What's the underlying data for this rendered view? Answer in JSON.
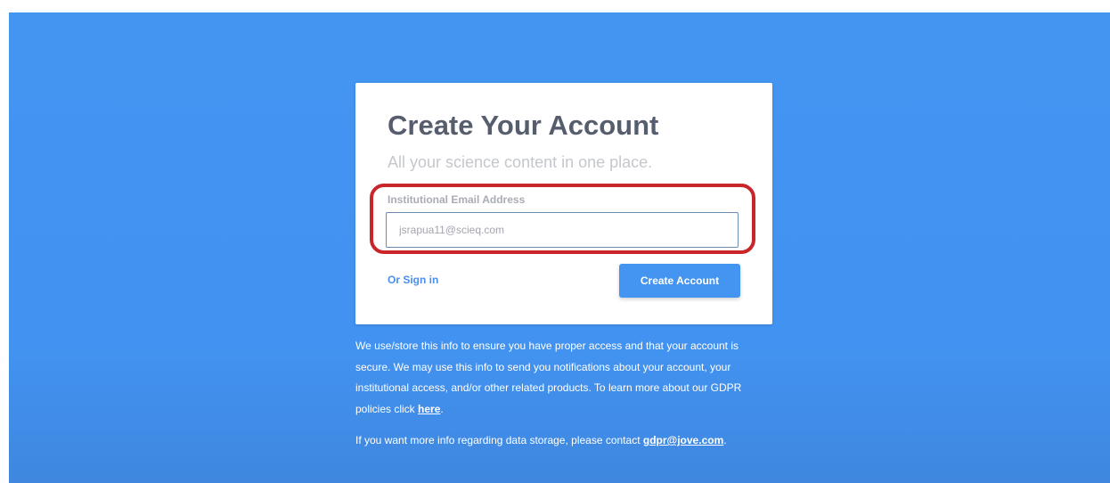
{
  "signup": {
    "title": "Create Your Account",
    "subtitle": "All your science content in one place.",
    "email_label": "Institutional Email Address",
    "email_value": "jsrapua11@scieq.com",
    "signin_link": "Or Sign in",
    "create_button": "Create Account"
  },
  "info": {
    "paragraph1_text": "We use/store this info to ensure you have proper access and that your account is secure. We may use this info to send you notifications about your account, your institutional access, and/or other related products. To learn more about our GDPR policies click ",
    "paragraph1_link": "here",
    "paragraph1_end": ".",
    "paragraph2_text": "If you want more info regarding data storage, please contact ",
    "paragraph2_link": "gdpr@jove.com",
    "paragraph2_end": "."
  },
  "colors": {
    "background": "#4494f2",
    "card": "#ffffff",
    "title": "#565e6e",
    "subtitle": "#c4c7cc",
    "accent": "#4494f2",
    "highlight": "#c9262b"
  }
}
